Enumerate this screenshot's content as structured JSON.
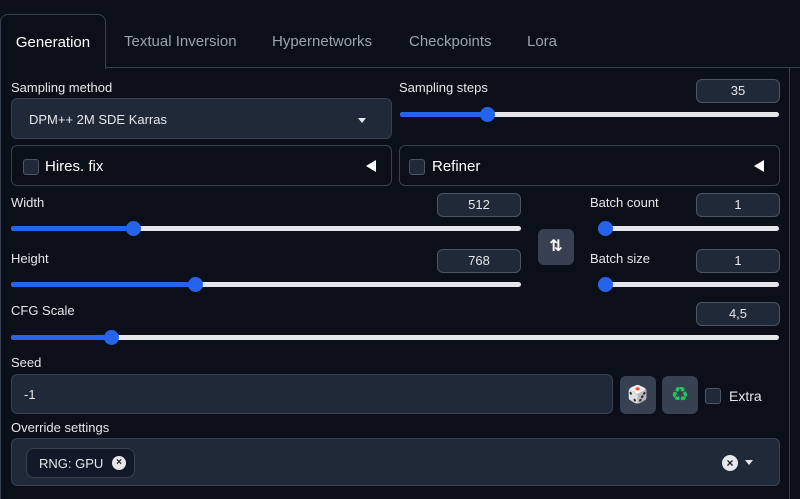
{
  "tabs": [
    {
      "label": "Generation",
      "active": true
    },
    {
      "label": "Textual Inversion",
      "active": false
    },
    {
      "label": "Hypernetworks",
      "active": false
    },
    {
      "label": "Checkpoints",
      "active": false
    },
    {
      "label": "Lora",
      "active": false
    }
  ],
  "sampling": {
    "method_label": "Sampling method",
    "method_value": "DPM++ 2M SDE Karras",
    "steps_label": "Sampling steps",
    "steps_value": "35",
    "steps_fraction": 0.23
  },
  "hires": {
    "label": "Hires. fix",
    "checked": false
  },
  "refiner": {
    "label": "Refiner",
    "checked": false
  },
  "width": {
    "label": "Width",
    "value": "512",
    "fraction": 0.24
  },
  "height": {
    "label": "Height",
    "value": "768",
    "fraction": 0.36
  },
  "swap": {
    "glyph": "⇅"
  },
  "batch_count": {
    "label": "Batch count",
    "value": "1",
    "fraction": 0.0
  },
  "batch_size": {
    "label": "Batch size",
    "value": "1",
    "fraction": 0.0
  },
  "cfg": {
    "label": "CFG Scale",
    "value": "4,5",
    "fraction": 0.13
  },
  "seed": {
    "label": "Seed",
    "value": "-1",
    "dice_glyph": "🎲",
    "recycle_glyph": "♻",
    "extra_label": "Extra",
    "extra_checked": false
  },
  "override": {
    "label": "Override settings",
    "chip_label": "RNG: GPU",
    "chip_close_glyph": "×",
    "clear_glyph": "×"
  },
  "colors": {
    "accent": "#2563eb",
    "background": "#0b0f19",
    "recycle": "#22c55e"
  }
}
